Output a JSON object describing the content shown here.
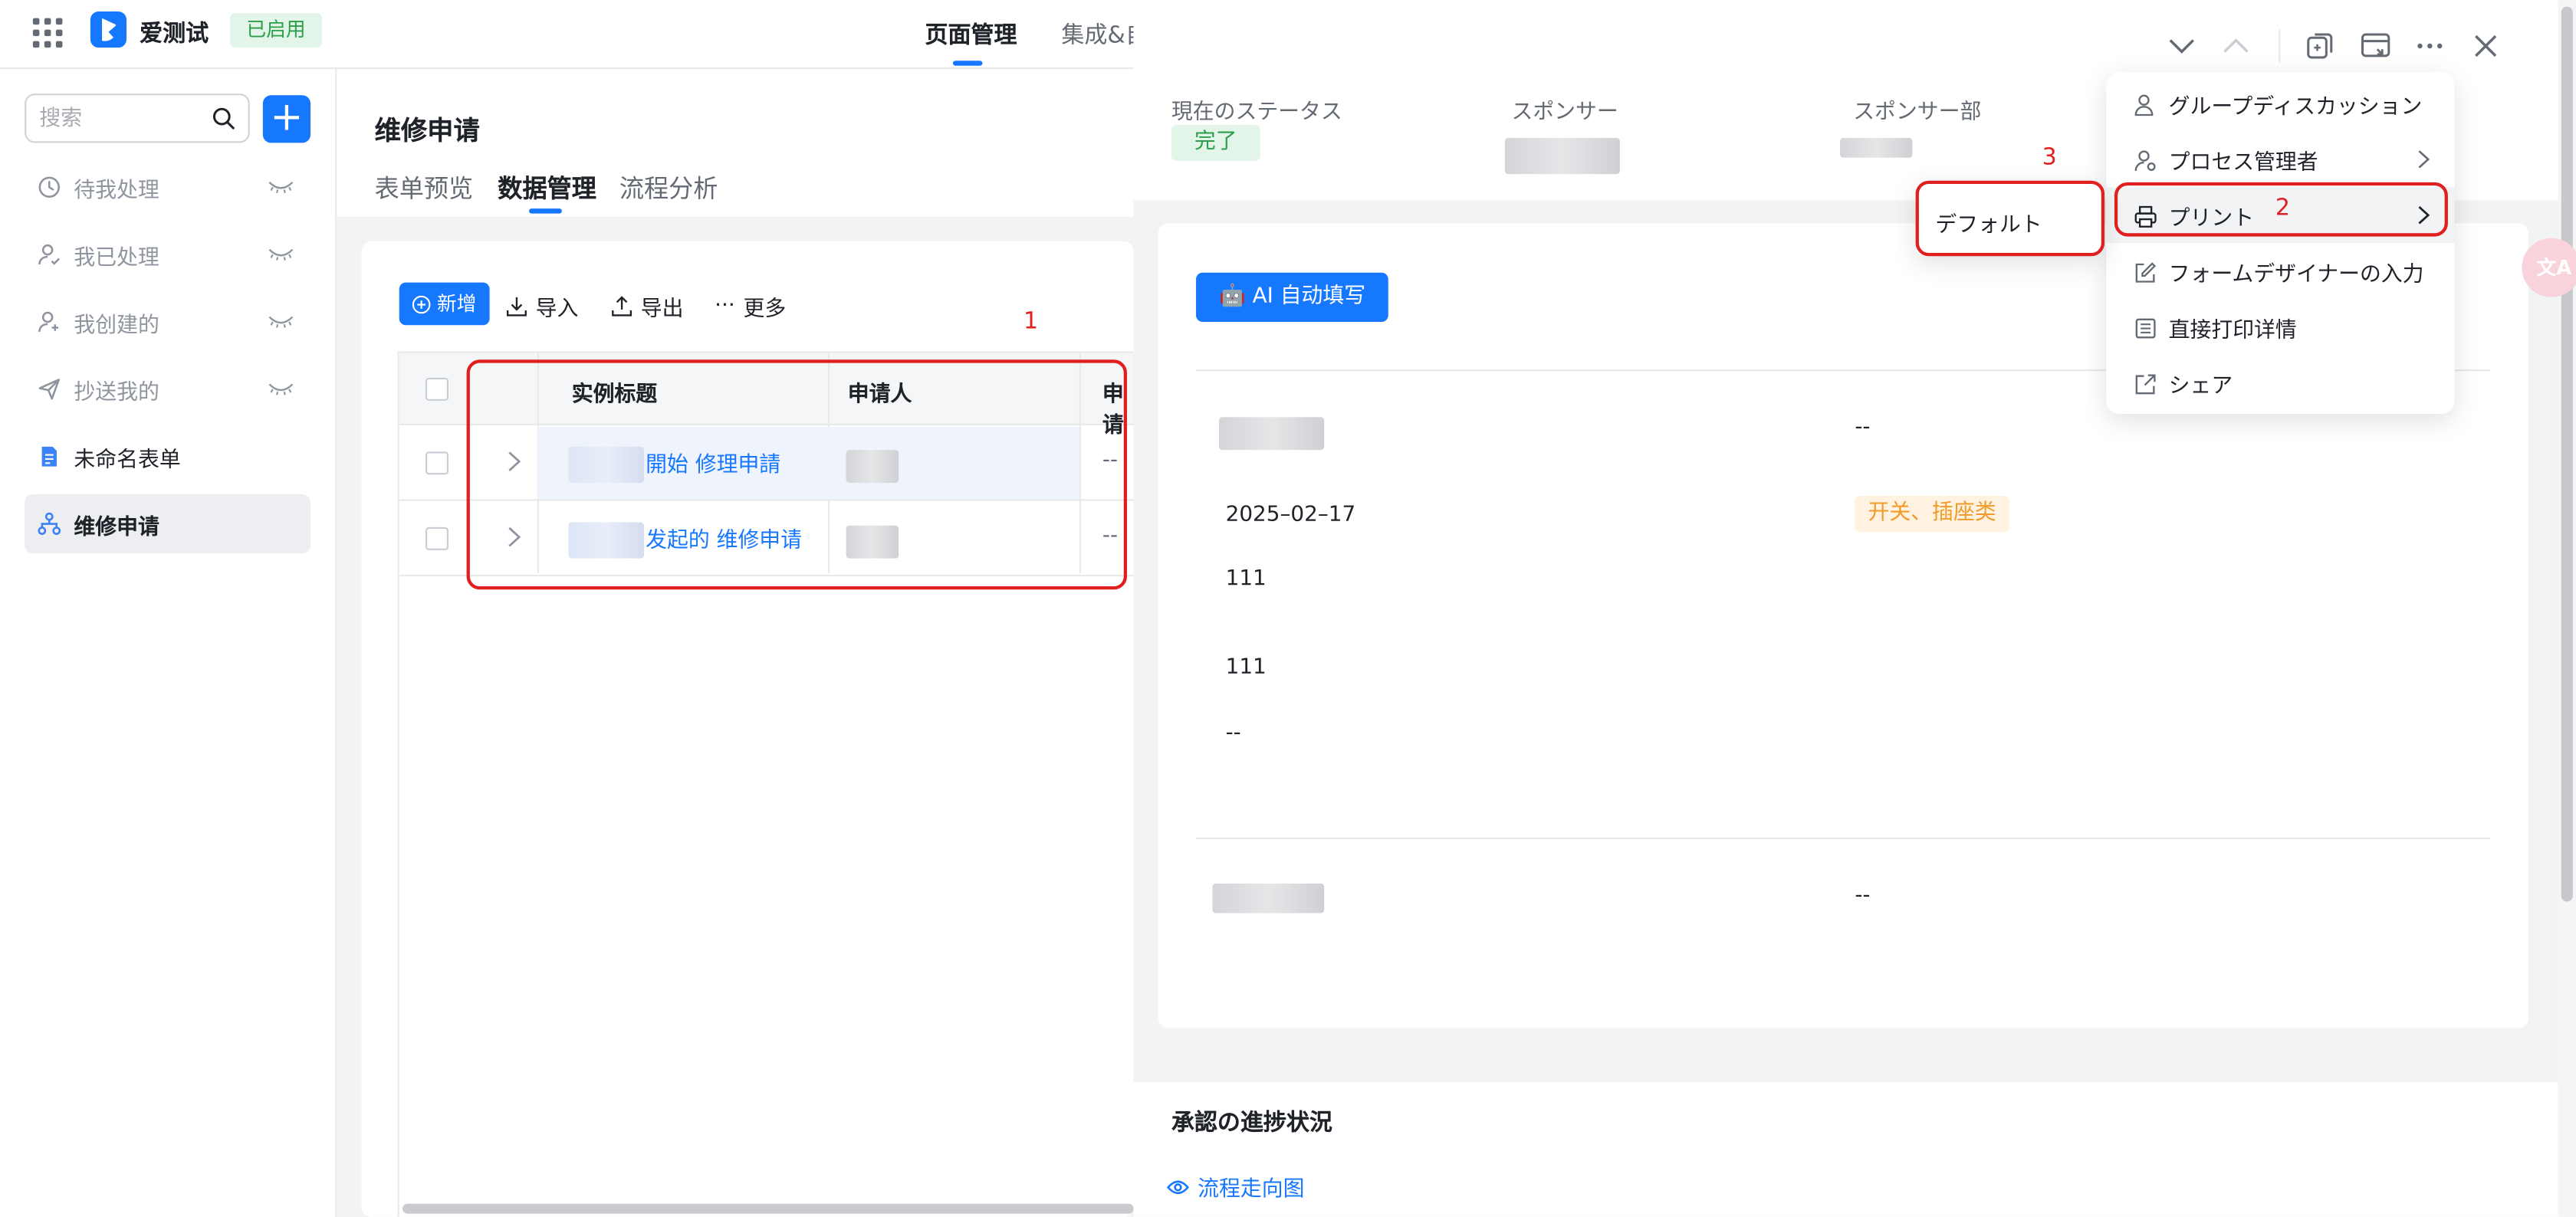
{
  "topbar": {
    "app_name": "爱测试",
    "status_badge": "已启用",
    "tabs": [
      {
        "label": "页面管理",
        "active": true
      },
      {
        "label": "集成&自"
      }
    ]
  },
  "sidebar": {
    "search": {
      "placeholder": "搜索",
      "value": ""
    },
    "add_label": "+",
    "items": [
      {
        "label": "待我处理",
        "icon": "clock-icon",
        "hidden": true
      },
      {
        "label": "我已处理",
        "icon": "user-check-icon",
        "hidden": true
      },
      {
        "label": "我创建的",
        "icon": "user-add-icon",
        "hidden": true
      },
      {
        "label": "抄送我的",
        "icon": "send-icon",
        "hidden": true
      },
      {
        "label": "未命名表单",
        "icon": "form-doc-icon"
      },
      {
        "label": "维修申请",
        "icon": "workflow-icon",
        "active": true
      }
    ]
  },
  "main": {
    "title": "维修申请",
    "subtabs": [
      {
        "label": "表单预览"
      },
      {
        "label": "数据管理",
        "active": true
      },
      {
        "label": "流程分析"
      }
    ],
    "toolbar": {
      "new_label": "新增",
      "import_label": "导入",
      "export_label": "导出",
      "more_label": "更多"
    },
    "table": {
      "columns": [
        "实例标题",
        "申请人",
        "申请"
      ],
      "rows": [
        {
          "title": "開始 修理申請",
          "col3": "--"
        },
        {
          "title": "发起的 维修申请",
          "col3": "--"
        }
      ]
    }
  },
  "drawer": {
    "meta": [
      {
        "label": "現在のステータス",
        "value": "完了"
      },
      {
        "label": "スポンサー"
      },
      {
        "label": "スポンサー部"
      }
    ],
    "ai_fill_label": "🤖 AI 自动填写",
    "fields": {
      "row1_right": "--",
      "date": "2025–02–17",
      "category_tag": "开关、插座类",
      "text1": "111",
      "text2": "111",
      "empty": "--",
      "row_bottom_right": "--"
    },
    "approval_title": "承認の進捗状況",
    "flow_link": "流程走向图"
  },
  "menu": {
    "items": [
      {
        "label": "グループディスカッション",
        "icon": "group-user-icon"
      },
      {
        "label": "プロセス管理者",
        "icon": "admin-user-icon",
        "has_submenu": true
      },
      {
        "label": "プリント",
        "icon": "printer-icon",
        "has_submenu": true,
        "highlighted": true
      },
      {
        "label": "フォームデザイナーの入力",
        "icon": "edit-icon"
      },
      {
        "label": "直接打印详情",
        "icon": "print-detail-icon"
      },
      {
        "label": "シェア",
        "icon": "share-icon"
      }
    ],
    "submenu_label": "デフォルト"
  },
  "annotations": {
    "n1": "1",
    "n2": "2",
    "n3": "3"
  },
  "translate_fab": "文A",
  "colors": {
    "accent": "#1677ff",
    "annotation": "#e02020",
    "success": "#2b9f4c",
    "warning": "#f39b2a"
  }
}
